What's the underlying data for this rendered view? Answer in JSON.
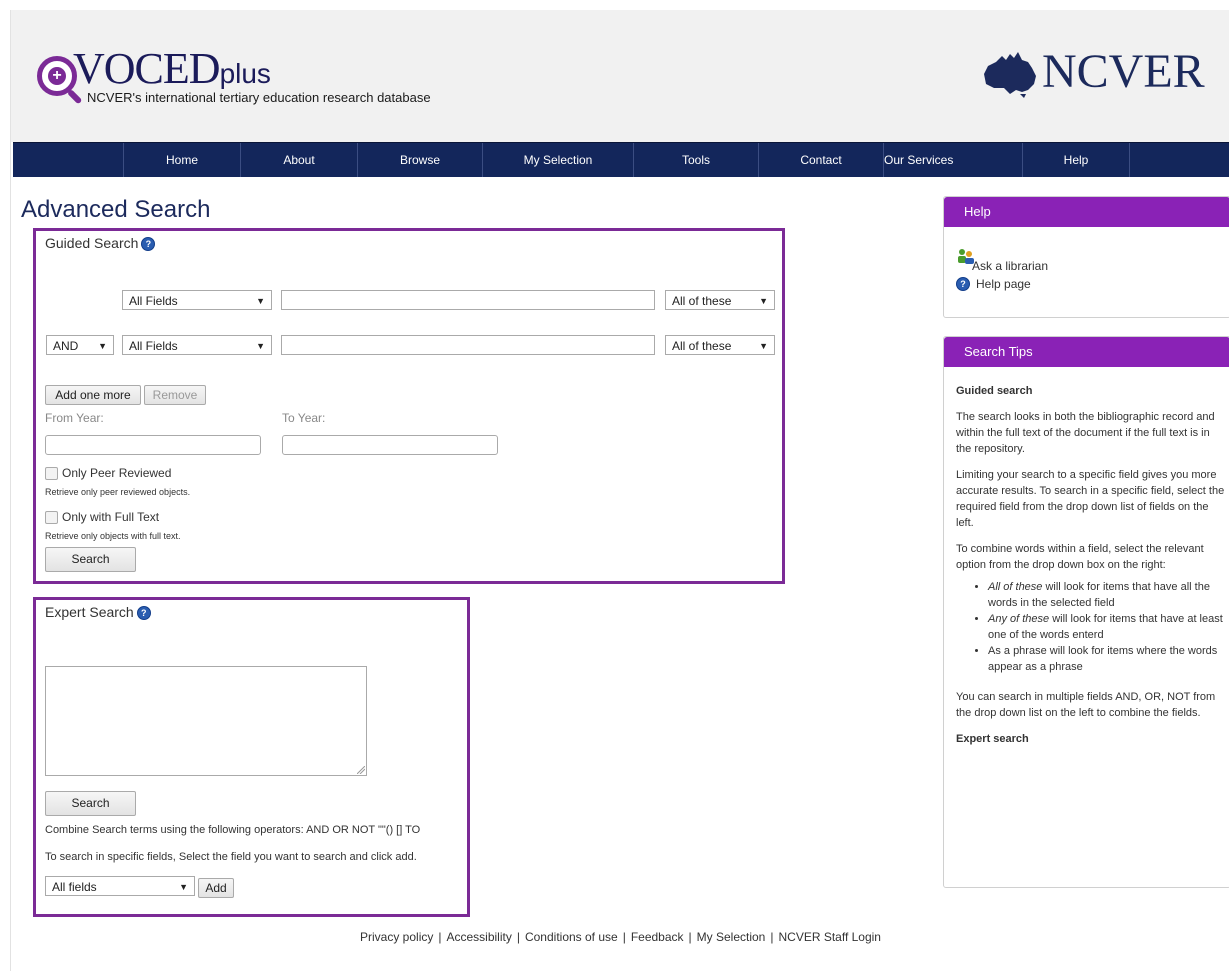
{
  "header": {
    "logo_main": "VOCED",
    "logo_suffix": "plus",
    "logo_plus_symbol": "+",
    "tagline": "NCVER's international tertiary education research database",
    "partner_logo": "NCVER"
  },
  "nav": {
    "items": [
      {
        "label": "Home"
      },
      {
        "label": "About"
      },
      {
        "label": "Browse"
      },
      {
        "label": "My Selection"
      },
      {
        "label": "Tools"
      },
      {
        "label": "Contact"
      },
      {
        "label": "Our Services"
      },
      {
        "label": "Help"
      }
    ]
  },
  "page_title": "Advanced Search",
  "guided": {
    "title": "Guided Search",
    "help_symbol": "?",
    "row1": {
      "field": "All Fields",
      "term": "",
      "match": "All of these"
    },
    "row2": {
      "operator": "AND",
      "field": "All Fields",
      "term": "",
      "match": "All of these"
    },
    "add_label": "Add one more",
    "remove_label": "Remove",
    "from_year_label": "From Year:",
    "to_year_label": "To Year:",
    "peer_label": "Only Peer Reviewed",
    "peer_desc": "Retrieve only peer reviewed objects.",
    "fulltext_label": "Only with Full Text",
    "fulltext_desc": "Retrieve only objects with full text.",
    "search_label": "Search"
  },
  "expert": {
    "title": "Expert Search",
    "help_symbol": "?",
    "query": "",
    "search_label": "Search",
    "operators_text": "Combine Search terms using the following operators: AND OR NOT \"\"() [] TO",
    "fields_text": "To search in specific fields, Select the field you want to search and click add.",
    "field_select": "All fields",
    "add_label": "Add"
  },
  "help_panel": {
    "title": "Help",
    "ask_librarian": "Ask a librarian",
    "help_page": "Help page"
  },
  "tips_panel": {
    "title": "Search Tips",
    "guided_heading": "Guided search",
    "p1": "The search looks in both the bibliographic record and within the full text of the document if the full text is in the repository.",
    "p2": "Limiting your search to a specific field gives you more accurate results. To search in a specific field, select the required field from the drop down list of fields on the left.",
    "p3": "To combine words within a field, select the relevant option from the drop down box on the right:",
    "bullet1_em": "All of these",
    "bullet1_rest": " will look for items that have all the words in the selected field",
    "bullet2_em": "Any of these",
    "bullet2_rest": " will look for items that have at least one of the words enterd",
    "bullet3": "As a phrase will look for items where the words appear as a phrase",
    "p4": "You can search in multiple fields AND, OR, NOT from the drop down list on the left to combine the fields.",
    "expert_heading": "Expert search"
  },
  "footer": {
    "links": [
      "Privacy policy",
      "Accessibility",
      "Conditions of use",
      "Feedback",
      "My Selection",
      "NCVER Staff Login"
    ],
    "separator": "|"
  },
  "colors": {
    "brand_purple": "#7b2a96",
    "nav_navy": "#13265b",
    "panel_purple": "#8a22b6"
  }
}
